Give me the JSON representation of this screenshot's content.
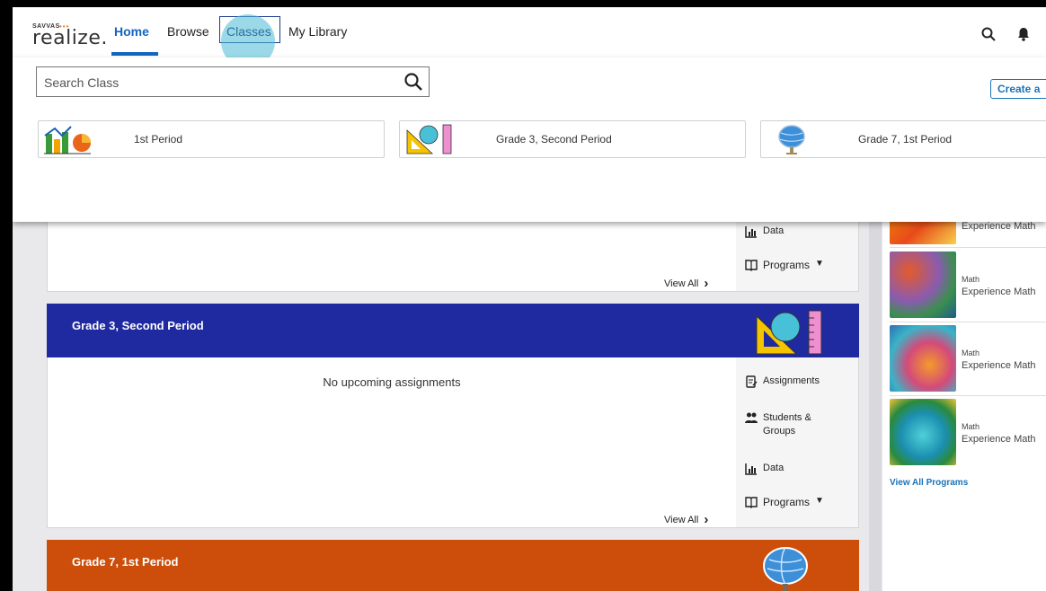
{
  "header": {
    "logo_small": "SAVVAS",
    "logo_word": "realize.",
    "nav": [
      {
        "label": "Home"
      },
      {
        "label": "Browse"
      },
      {
        "label": "Classes"
      },
      {
        "label": "My Library"
      }
    ],
    "active_nav": "Home",
    "accent_color": "#1565c0",
    "icons": [
      "search-icon",
      "bell-icon"
    ]
  },
  "classes_dropdown": {
    "search_placeholder": "Search Class",
    "create_button_label": "Create a",
    "classes": [
      {
        "name": "1st Period",
        "icon": "bar-chart-icon"
      },
      {
        "name": "Grade 3, Second Period",
        "icon": "geometry-tools-icon"
      },
      {
        "name": "Grade 7, 1st Period",
        "icon": "globe-icon"
      }
    ]
  },
  "dashboard": {
    "first_card_links": {
      "data": "Data",
      "programs": "Programs",
      "view_all": "View All"
    },
    "class_cards": [
      {
        "title": "Grade 3, Second Period",
        "banner_color": "#1f2aa0",
        "message": "No upcoming assignments",
        "links": {
          "assignments": "Assignments",
          "students_groups_line1": "Students &",
          "students_groups_line2": "Groups",
          "data": "Data",
          "programs": "Programs"
        },
        "view_all": "View All"
      },
      {
        "title": "Grade 7, 1st Period",
        "banner_color": "#cc4e0a"
      }
    ]
  },
  "programs_sidebar": {
    "partial_top_name": "Experience Math",
    "items": [
      {
        "subject": "Math",
        "name": "Experience Math"
      },
      {
        "subject": "Math",
        "name": "Experience Math"
      },
      {
        "subject": "Math",
        "name": "Experience Math"
      }
    ],
    "view_all_label": "View All Programs"
  }
}
